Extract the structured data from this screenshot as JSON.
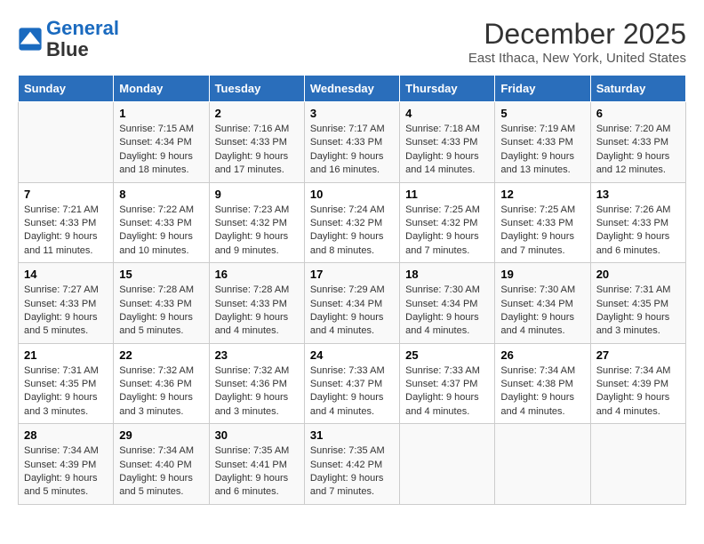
{
  "header": {
    "logo_line1": "General",
    "logo_line2": "Blue",
    "title": "December 2025",
    "subtitle": "East Ithaca, New York, United States"
  },
  "days_of_week": [
    "Sunday",
    "Monday",
    "Tuesday",
    "Wednesday",
    "Thursday",
    "Friday",
    "Saturday"
  ],
  "weeks": [
    [
      {
        "day": "",
        "sunrise": "",
        "sunset": "",
        "daylight": ""
      },
      {
        "day": "1",
        "sunrise": "7:15 AM",
        "sunset": "4:34 PM",
        "daylight": "9 hours and 18 minutes."
      },
      {
        "day": "2",
        "sunrise": "7:16 AM",
        "sunset": "4:33 PM",
        "daylight": "9 hours and 17 minutes."
      },
      {
        "day": "3",
        "sunrise": "7:17 AM",
        "sunset": "4:33 PM",
        "daylight": "9 hours and 16 minutes."
      },
      {
        "day": "4",
        "sunrise": "7:18 AM",
        "sunset": "4:33 PM",
        "daylight": "9 hours and 14 minutes."
      },
      {
        "day": "5",
        "sunrise": "7:19 AM",
        "sunset": "4:33 PM",
        "daylight": "9 hours and 13 minutes."
      },
      {
        "day": "6",
        "sunrise": "7:20 AM",
        "sunset": "4:33 PM",
        "daylight": "9 hours and 12 minutes."
      }
    ],
    [
      {
        "day": "7",
        "sunrise": "7:21 AM",
        "sunset": "4:33 PM",
        "daylight": "9 hours and 11 minutes."
      },
      {
        "day": "8",
        "sunrise": "7:22 AM",
        "sunset": "4:33 PM",
        "daylight": "9 hours and 10 minutes."
      },
      {
        "day": "9",
        "sunrise": "7:23 AM",
        "sunset": "4:32 PM",
        "daylight": "9 hours and 9 minutes."
      },
      {
        "day": "10",
        "sunrise": "7:24 AM",
        "sunset": "4:32 PM",
        "daylight": "9 hours and 8 minutes."
      },
      {
        "day": "11",
        "sunrise": "7:25 AM",
        "sunset": "4:32 PM",
        "daylight": "9 hours and 7 minutes."
      },
      {
        "day": "12",
        "sunrise": "7:25 AM",
        "sunset": "4:33 PM",
        "daylight": "9 hours and 7 minutes."
      },
      {
        "day": "13",
        "sunrise": "7:26 AM",
        "sunset": "4:33 PM",
        "daylight": "9 hours and 6 minutes."
      }
    ],
    [
      {
        "day": "14",
        "sunrise": "7:27 AM",
        "sunset": "4:33 PM",
        "daylight": "9 hours and 5 minutes."
      },
      {
        "day": "15",
        "sunrise": "7:28 AM",
        "sunset": "4:33 PM",
        "daylight": "9 hours and 5 minutes."
      },
      {
        "day": "16",
        "sunrise": "7:28 AM",
        "sunset": "4:33 PM",
        "daylight": "9 hours and 4 minutes."
      },
      {
        "day": "17",
        "sunrise": "7:29 AM",
        "sunset": "4:34 PM",
        "daylight": "9 hours and 4 minutes."
      },
      {
        "day": "18",
        "sunrise": "7:30 AM",
        "sunset": "4:34 PM",
        "daylight": "9 hours and 4 minutes."
      },
      {
        "day": "19",
        "sunrise": "7:30 AM",
        "sunset": "4:34 PM",
        "daylight": "9 hours and 4 minutes."
      },
      {
        "day": "20",
        "sunrise": "7:31 AM",
        "sunset": "4:35 PM",
        "daylight": "9 hours and 3 minutes."
      }
    ],
    [
      {
        "day": "21",
        "sunrise": "7:31 AM",
        "sunset": "4:35 PM",
        "daylight": "9 hours and 3 minutes."
      },
      {
        "day": "22",
        "sunrise": "7:32 AM",
        "sunset": "4:36 PM",
        "daylight": "9 hours and 3 minutes."
      },
      {
        "day": "23",
        "sunrise": "7:32 AM",
        "sunset": "4:36 PM",
        "daylight": "9 hours and 3 minutes."
      },
      {
        "day": "24",
        "sunrise": "7:33 AM",
        "sunset": "4:37 PM",
        "daylight": "9 hours and 4 minutes."
      },
      {
        "day": "25",
        "sunrise": "7:33 AM",
        "sunset": "4:37 PM",
        "daylight": "9 hours and 4 minutes."
      },
      {
        "day": "26",
        "sunrise": "7:34 AM",
        "sunset": "4:38 PM",
        "daylight": "9 hours and 4 minutes."
      },
      {
        "day": "27",
        "sunrise": "7:34 AM",
        "sunset": "4:39 PM",
        "daylight": "9 hours and 4 minutes."
      }
    ],
    [
      {
        "day": "28",
        "sunrise": "7:34 AM",
        "sunset": "4:39 PM",
        "daylight": "9 hours and 5 minutes."
      },
      {
        "day": "29",
        "sunrise": "7:34 AM",
        "sunset": "4:40 PM",
        "daylight": "9 hours and 5 minutes."
      },
      {
        "day": "30",
        "sunrise": "7:35 AM",
        "sunset": "4:41 PM",
        "daylight": "9 hours and 6 minutes."
      },
      {
        "day": "31",
        "sunrise": "7:35 AM",
        "sunset": "4:42 PM",
        "daylight": "9 hours and 7 minutes."
      },
      {
        "day": "",
        "sunrise": "",
        "sunset": "",
        "daylight": ""
      },
      {
        "day": "",
        "sunrise": "",
        "sunset": "",
        "daylight": ""
      },
      {
        "day": "",
        "sunrise": "",
        "sunset": "",
        "daylight": ""
      }
    ]
  ],
  "labels": {
    "sunrise": "Sunrise:",
    "sunset": "Sunset:",
    "daylight": "Daylight:"
  }
}
